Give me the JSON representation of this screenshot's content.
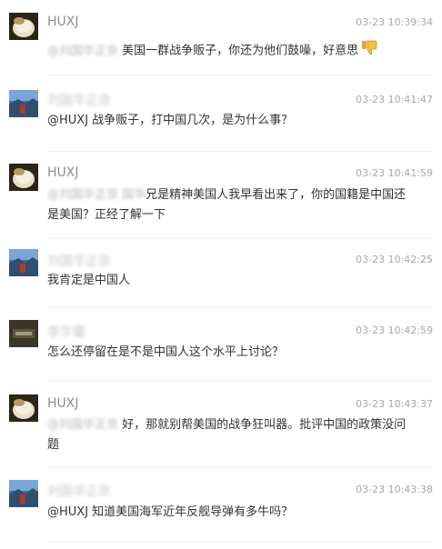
{
  "comments": [
    {
      "username": "HUXJ",
      "username_blurred": false,
      "avatar": "avatar-food-photo",
      "time": "03-23 10:39:34",
      "mention": "@刘国华正京",
      "text": " 美国一群战争贩子，你还为他们鼓噪，好意思",
      "emoji": "thumbs-down-icon"
    },
    {
      "username": "刘国华正京",
      "username_blurred": true,
      "avatar": "avatar-landscape-photo",
      "time": "03-23 10:41:47",
      "mention": "",
      "text": "@HUXJ 战争贩子，打中国几次，是为什么事？"
    },
    {
      "username": "HUXJ",
      "username_blurred": false,
      "avatar": "avatar-food-photo",
      "time": "03-23 10:41:59",
      "mention": "@刘国华正京 国华",
      "text": "兄是精神美国人我早看出来了，你的国籍是中国还是美国？正经了解一下"
    },
    {
      "username": "刘国华正京",
      "username_blurred": true,
      "avatar": "avatar-landscape-photo",
      "time": "03-23 10:42:25",
      "mention": "",
      "text": "我肯定是中国人"
    },
    {
      "username": "李华雷",
      "username_blurred": true,
      "avatar": "avatar-dark-image",
      "time": "03-23 10:42:59",
      "mention": "",
      "text": "怎么还停留在是不是中国人这个水平上讨论？"
    },
    {
      "username": "HUXJ",
      "username_blurred": false,
      "avatar": "avatar-food-photo",
      "time": "03-23 10:43:37",
      "mention": "@刘国华正京",
      "text": " 好，那就别帮美国的战争狂叫器。批评中国的政策没问题"
    },
    {
      "username": "刘国华正京",
      "username_blurred": true,
      "avatar": "avatar-landscape-photo",
      "time": "03-23 10:43:38",
      "mention": "",
      "text": "@HUXJ 知道美国海军近年反舰导弹有多牛吗？"
    }
  ]
}
